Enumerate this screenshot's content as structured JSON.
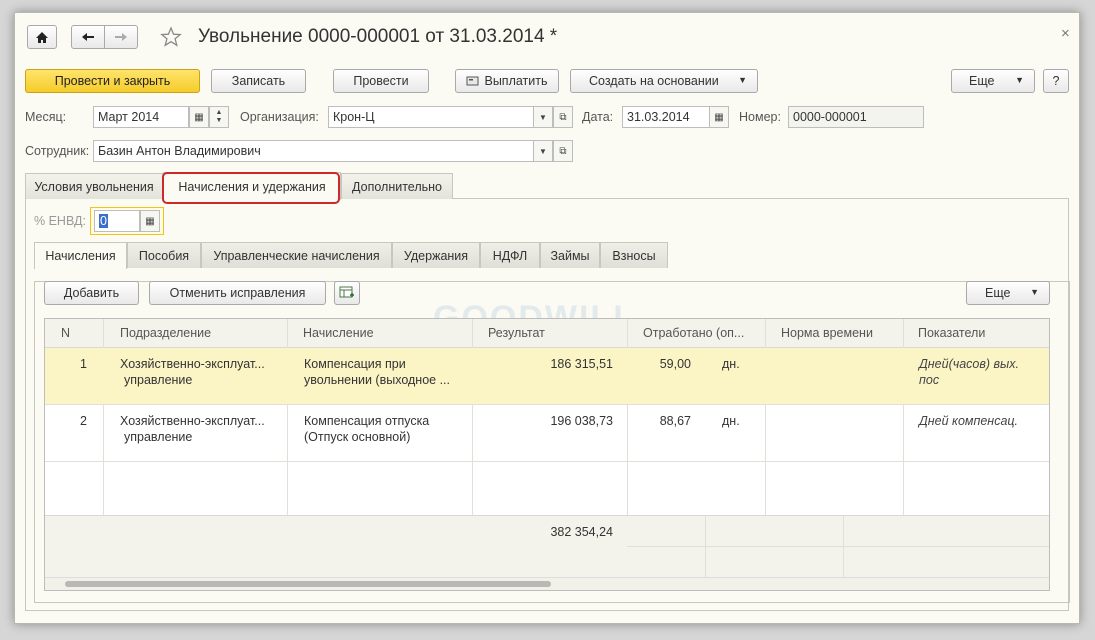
{
  "window": {
    "title": "Увольнение 0000-000001 от 31.03.2014 *",
    "close": "×"
  },
  "toolbar": {
    "post_close": "Провести и закрыть",
    "save": "Записать",
    "post": "Провести",
    "pay": "Выплатить",
    "create_based": "Создать на основании",
    "more": "Еще",
    "help": "?"
  },
  "form": {
    "month_label": "Месяц:",
    "month_value": "Март 2014",
    "org_label": "Организация:",
    "org_value": "Крон-Ц",
    "date_label": "Дата:",
    "date_value": "31.03.2014",
    "number_label": "Номер:",
    "number_value": "0000-000001",
    "employee_label": "Сотрудник:",
    "employee_value": "Базин Антон Владимирович"
  },
  "tabs": [
    "Условия увольнения",
    "Начисления и удержания",
    "Дополнительно"
  ],
  "envd": {
    "label": "% ЕНВД:",
    "value": "0"
  },
  "subtabs": [
    "Начисления",
    "Пособия",
    "Управленческие начисления",
    "Удержания",
    "НДФЛ",
    "Займы",
    "Взносы"
  ],
  "grid_toolbar": {
    "add": "Добавить",
    "cancel_fix": "Отменить исправления",
    "more": "Еще"
  },
  "watermark": "GOODWILL",
  "table": {
    "headers": [
      "N",
      "Подразделение",
      "Начисление",
      "Результат",
      "Отработано (оп...",
      "Норма времени",
      "Показатели"
    ],
    "rows": [
      {
        "n": "1",
        "dept1": "Хозяйственно-эксплуат...",
        "dept2": "управление",
        "acc1": "Компенсация при",
        "acc2": "увольнении (выходное ...",
        "result": "186 315,51",
        "worked": "59,00",
        "unit": "дн.",
        "ind1": "Дней(часов) вых.",
        "ind2": "пос"
      },
      {
        "n": "2",
        "dept1": "Хозяйственно-эксплуат...",
        "dept2": "управление",
        "acc1": "Компенсация отпуска",
        "acc2": "(Отпуск основной)",
        "result": "196 038,73",
        "worked": "88,67",
        "unit": "дн.",
        "ind1": "Дней компенсац.",
        "ind2": ""
      }
    ],
    "total": "382 354,24"
  },
  "colors": {
    "accent_yellow": "#f5cc2b",
    "selected_row": "#fbf5c6",
    "highlight_red": "#cc2a2a",
    "focus_yellow": "#f0c419"
  }
}
